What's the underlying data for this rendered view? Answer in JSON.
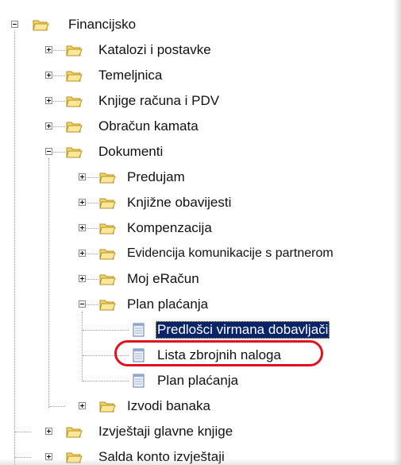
{
  "tree": {
    "nodes": [
      {
        "id": "financijsko",
        "label": "Financijsko",
        "type": "folder",
        "state": "expanded"
      },
      {
        "id": "katalozi",
        "label": "Katalozi i postavke",
        "type": "folder",
        "state": "collapsed"
      },
      {
        "id": "temeljnica",
        "label": "Temeljnica",
        "type": "folder",
        "state": "collapsed"
      },
      {
        "id": "knjige",
        "label": "Knjige računa i PDV",
        "type": "folder",
        "state": "collapsed"
      },
      {
        "id": "obracun",
        "label": "Obračun kamata",
        "type": "folder",
        "state": "collapsed"
      },
      {
        "id": "dokumenti",
        "label": "Dokumenti",
        "type": "folder",
        "state": "expanded"
      },
      {
        "id": "predujam",
        "label": "Predujam",
        "type": "folder",
        "state": "collapsed"
      },
      {
        "id": "knjizne",
        "label": "Knjižne obavijesti",
        "type": "folder",
        "state": "collapsed"
      },
      {
        "id": "kompenzacija",
        "label": "Kompenzacija",
        "type": "folder",
        "state": "collapsed"
      },
      {
        "id": "evidencija",
        "label": "Evidencija komunikacije s partnerom",
        "type": "folder",
        "state": "collapsed"
      },
      {
        "id": "moj-eracun",
        "label": "Moj eRačun",
        "type": "folder",
        "state": "collapsed"
      },
      {
        "id": "plan-placanja-folder",
        "label": "Plan plaćanja",
        "type": "folder",
        "state": "expanded"
      },
      {
        "id": "predlosci",
        "label": "Predlošci virmana dobavljači",
        "type": "document",
        "selected": true
      },
      {
        "id": "lista",
        "label": "Lista zbrojnih naloga",
        "type": "document",
        "highlighted": true
      },
      {
        "id": "plan-placanja-doc",
        "label": "Plan plaćanja",
        "type": "document"
      },
      {
        "id": "izvodi",
        "label": "Izvodi banaka",
        "type": "folder",
        "state": "collapsed"
      },
      {
        "id": "izvjestaji",
        "label": "Izvještaji glavne knjige",
        "type": "folder",
        "state": "collapsed"
      },
      {
        "id": "salda",
        "label": "Salda konto izvještaji",
        "type": "folder",
        "state": "collapsed"
      }
    ]
  },
  "colors": {
    "selection_bg": "#0a246a",
    "highlight_oval": "#e0121f",
    "folder_yellow": "#f2c94c"
  }
}
